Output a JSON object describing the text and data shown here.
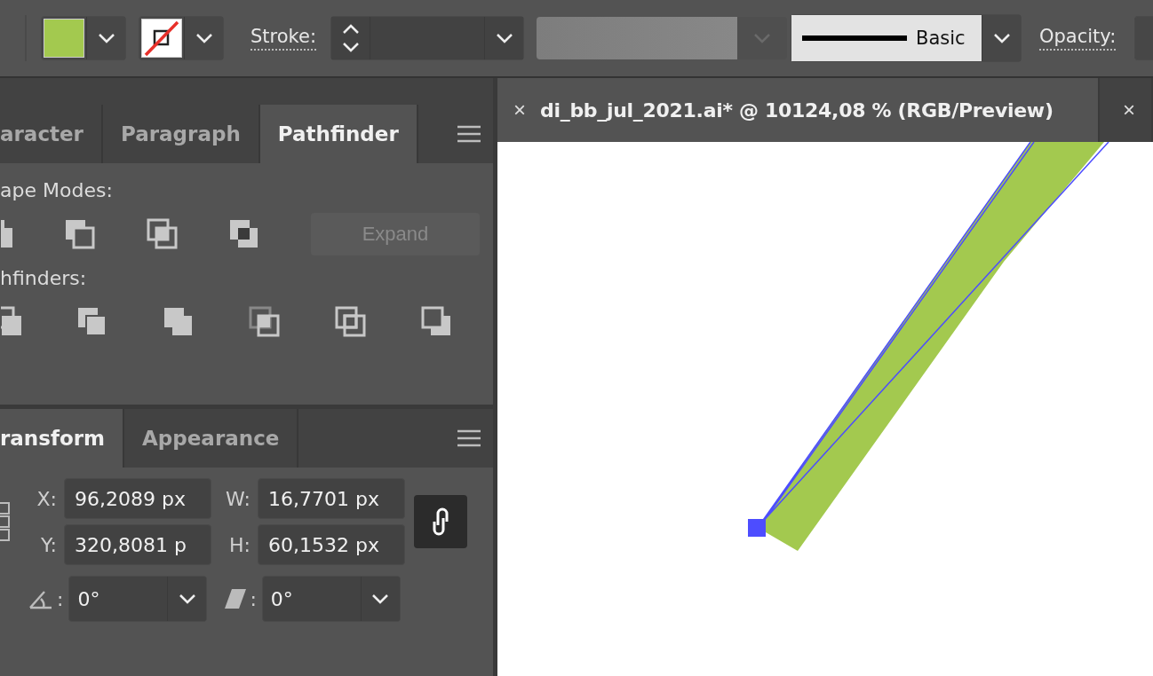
{
  "control_bar": {
    "stroke_label": "Stroke:",
    "brush": {
      "label": "Basic"
    },
    "opacity_label": "Opacity:"
  },
  "panel_top": {
    "tabs": [
      {
        "label": "aracter",
        "selected": false
      },
      {
        "label": "Paragraph",
        "selected": false
      },
      {
        "label": "Pathfinder",
        "selected": true
      }
    ],
    "shape_modes_label": "ape Modes:",
    "expand_button": {
      "label": "Expand",
      "disabled": true
    },
    "pathfinders_label": "hfinders:"
  },
  "panel_bottom": {
    "tabs": [
      {
        "label": "ransform",
        "selected": true
      },
      {
        "label": "Appearance",
        "selected": false
      }
    ],
    "fields": [
      {
        "label": "X:",
        "value": "96,2089 px"
      },
      {
        "label": "W:",
        "value": "16,7701 px"
      },
      {
        "label": "Y:",
        "value": "320,8081 p"
      },
      {
        "label": "H:",
        "value": "60,1532 px"
      }
    ],
    "constrain_proportions": {
      "on": true
    },
    "angle_fields": [
      {
        "kind": "rotate",
        "label": ":",
        "value": "0°"
      },
      {
        "kind": "shear",
        "label": ":",
        "value": "0°"
      }
    ]
  },
  "document": {
    "tabs": [
      {
        "close": "×",
        "title": "di_bb_jul_2021.ai* @ 10124,08 % (RGB/Preview)",
        "selected": true
      },
      {
        "close": "×",
        "selected": false
      }
    ]
  }
}
